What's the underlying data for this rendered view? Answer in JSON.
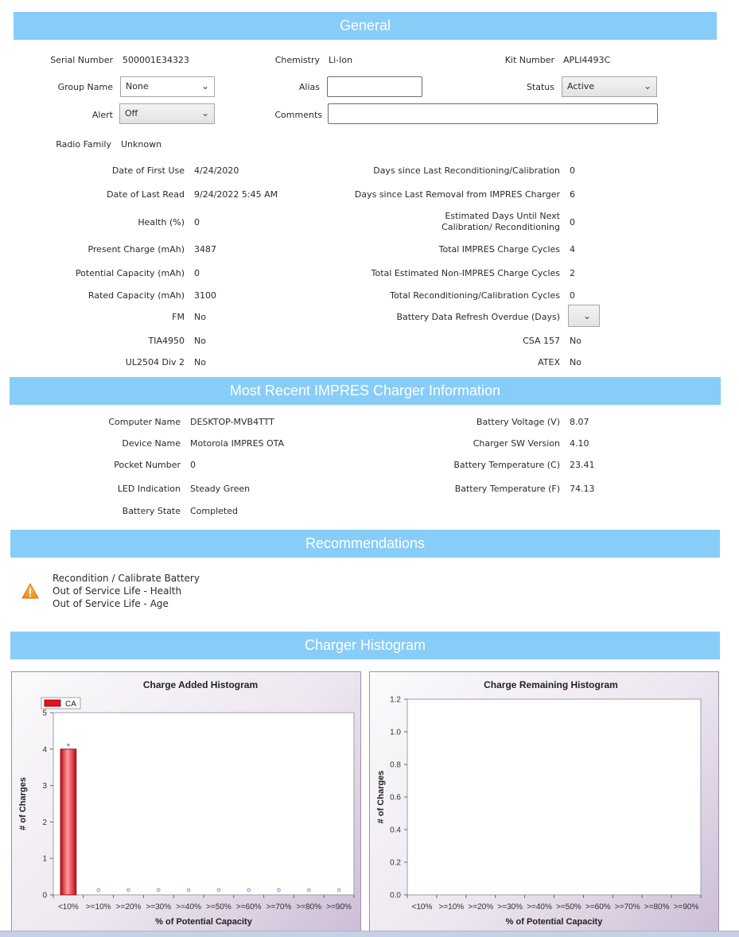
{
  "general": {
    "title": "General",
    "serial_number": {
      "label": "Serial Number",
      "value": "500001E34323"
    },
    "chemistry": {
      "label": "Chemistry",
      "value": "Li-Ion"
    },
    "kit_number": {
      "label": "Kit Number",
      "value": "APLI4493C"
    },
    "group_name": {
      "label": "Group Name",
      "value": "None"
    },
    "alias": {
      "label": "Alias",
      "value": ""
    },
    "status": {
      "label": "Status",
      "value": "Active"
    },
    "alert": {
      "label": "Alert",
      "value": "Off"
    },
    "comments": {
      "label": "Comments",
      "value": ""
    },
    "radio_family": {
      "label": "Radio Family",
      "value": "Unknown"
    },
    "left_fields": [
      {
        "label": "Date of First Use",
        "value": "4/24/2020"
      },
      {
        "label": "Date of Last Read",
        "value": "9/24/2022 5:45 AM"
      },
      {
        "label": "Health (%)",
        "value": "0"
      },
      {
        "label": "Present Charge (mAh)",
        "value": "3487"
      },
      {
        "label": "Potential Capacity (mAh)",
        "value": "0"
      },
      {
        "label": "Rated Capacity (mAh)",
        "value": "3100"
      },
      {
        "label": "FM",
        "value": "No"
      },
      {
        "label": "TIA4950",
        "value": "No"
      },
      {
        "label": "UL2504 Div 2",
        "value": "No"
      }
    ],
    "right_fields": [
      {
        "label": "Days since Last Reconditioning/Calibration",
        "value": "0"
      },
      {
        "label": "Days since Last Removal from IMPRES Charger",
        "value": "6"
      },
      {
        "label": "Estimated Days Until Next Calibration/ Reconditioning",
        "value": "0"
      },
      {
        "label": "Total IMPRES Charge Cycles",
        "value": "4"
      },
      {
        "label": "Total Estimated Non-IMPRES Charge Cycles",
        "value": "2"
      },
      {
        "label": "Total Reconditioning/Calibration Cycles",
        "value": "0"
      },
      {
        "label": "Battery Data Refresh Overdue (Days)",
        "value": ""
      },
      {
        "label": "CSA 157",
        "value": "No"
      },
      {
        "label": "ATEX",
        "value": "No"
      }
    ]
  },
  "charger": {
    "title": "Most Recent IMPRES Charger Information",
    "left_fields": [
      {
        "label": "Computer Name",
        "value": "DESKTOP-MVB4TTT"
      },
      {
        "label": "Device Name",
        "value": "Motorola IMPRES OTA"
      },
      {
        "label": "Pocket Number",
        "value": "0"
      },
      {
        "label": "LED Indication",
        "value": "Steady Green"
      },
      {
        "label": "Battery State",
        "value": "Completed"
      }
    ],
    "right_fields": [
      {
        "label": "Battery Voltage (V)",
        "value": "8.07"
      },
      {
        "label": "Charger SW Version",
        "value": "4.10"
      },
      {
        "label": "Battery Temperature (C)",
        "value": "23.41"
      },
      {
        "label": "Battery Temperature (F)",
        "value": "74.13"
      }
    ]
  },
  "recommendations": {
    "title": "Recommendations",
    "icon": "warning-icon",
    "items": [
      "Recondition / Calibrate Battery",
      "Out of Service Life - Health",
      "Out of Service Life - Age"
    ]
  },
  "histogram": {
    "title": "Charger Histogram"
  },
  "chart_data": [
    {
      "type": "bar",
      "title": "Charge Added Histogram",
      "xlabel": "% of Potential Capacity",
      "ylabel": "# of Charges",
      "categories": [
        "<10%",
        ">=10%",
        ">=20%",
        ">=30%",
        ">=40%",
        ">=50%",
        ">=60%",
        ">=70%",
        ">=80%",
        ">=90%"
      ],
      "series": [
        {
          "name": "CA",
          "values": [
            4,
            0,
            0,
            0,
            0,
            0,
            0,
            0,
            0,
            0
          ],
          "color": "#e0141e"
        }
      ],
      "ylim": [
        0,
        5
      ],
      "yticks": [
        "0",
        "1",
        "2",
        "3",
        "4",
        "5"
      ],
      "grid": false,
      "legend": "top-left"
    },
    {
      "type": "bar",
      "title": "Charge Remaining Histogram",
      "xlabel": "% of Potential Capacity",
      "ylabel": "# of Charges",
      "categories": [
        "<10%",
        ">=10%",
        ">=20%",
        ">=30%",
        ">=40%",
        ">=50%",
        ">=60%",
        ">=70%",
        ">=80%",
        ">=90%"
      ],
      "series": [],
      "ylim": [
        0,
        1.2
      ],
      "yticks": [
        "0.0",
        "0.2",
        "0.4",
        "0.6",
        "0.8",
        "1.0",
        "1.2"
      ],
      "grid": false
    }
  ]
}
